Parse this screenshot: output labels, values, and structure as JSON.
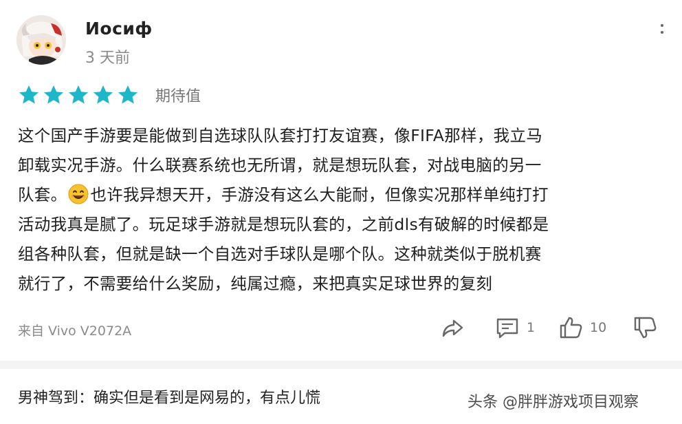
{
  "comment": {
    "username": "Иосиф",
    "time": "3 天前",
    "rating": {
      "stars": 5,
      "max": 5,
      "label": "期待值",
      "star_color": "#1eb6c9"
    },
    "text_lines": [
      "这个国产手游要是能做到自选球队队套打打友谊赛，像FIFA那样，我立马",
      "卸载实况手游。什么联赛系统也无所谓，就是想玩队套，对战电脑的另一",
      "也许我异想天开，手游没有这么大能耐，但像实况那样单纯打打",
      "活动我真是腻了。玩足球手游就是想玩队套的，之前dls有破解的时候都是",
      "组各种队套，但就是缺一个自选对手球队是哪个队。这种就类似于脱机赛",
      "就行了，不需要给什么奖励，纯属过瘾，来把真实足球世界的复刻"
    ],
    "line3_prefix": "队套。",
    "device": "来自 Vivo V2072A",
    "actions": {
      "reply_count": "1",
      "like_count": "10"
    }
  },
  "reply": {
    "text": "男神驾到：确实但是看到是网易的，有点儿慌"
  },
  "watermark": "头条 @胖胖游戏项目观察",
  "colors": {
    "accent": "#1eb6c9",
    "muted": "#8a8a8a",
    "icon": "#666666"
  }
}
